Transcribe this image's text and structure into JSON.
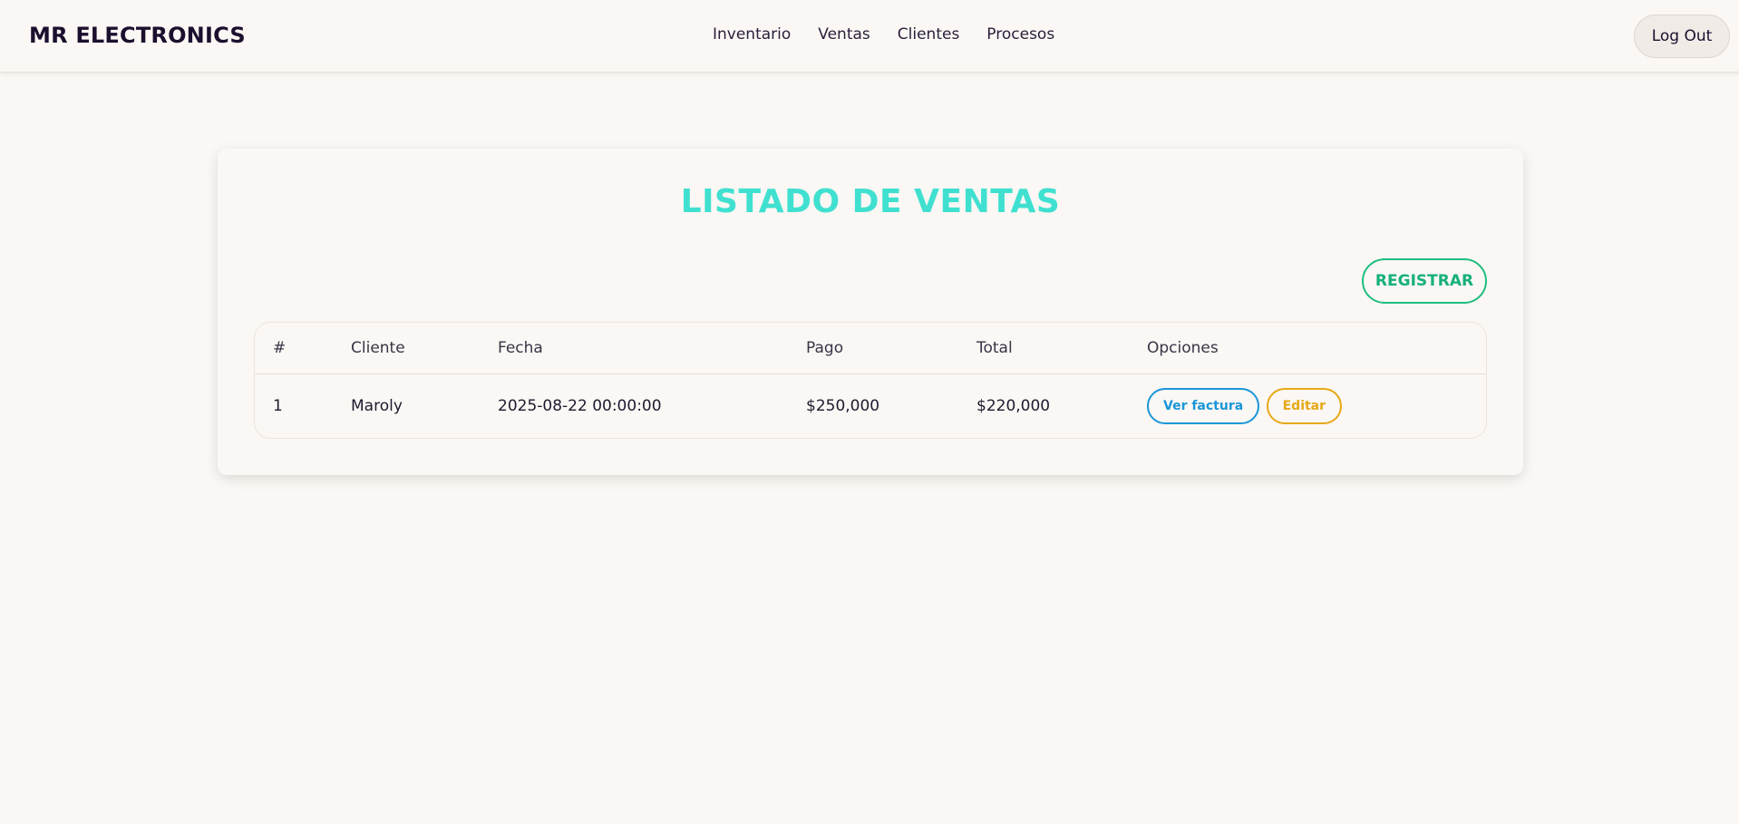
{
  "navbar": {
    "brand": "MR ELECTRONICS",
    "links": [
      "Inventario",
      "Ventas",
      "Clientes",
      "Procesos"
    ],
    "logout_label": "Log Out"
  },
  "page": {
    "title": "LISTADO DE VENTAS",
    "register_label": "REGISTRAR"
  },
  "table": {
    "headers": [
      "#",
      "Cliente",
      "Fecha",
      "Pago",
      "Total",
      "Opciones"
    ],
    "rows": [
      {
        "num": "1",
        "cliente": "Maroly",
        "fecha": "2025-08-22 00:00:00",
        "pago": "$250,000",
        "total": "$220,000",
        "view_label": "Ver factura",
        "edit_label": "Editar"
      }
    ]
  },
  "colors": {
    "title": "#40e0d0",
    "register": "#17b07b",
    "view": "#1a96d8",
    "edit": "#e6a817",
    "background": "#faf7f4"
  }
}
